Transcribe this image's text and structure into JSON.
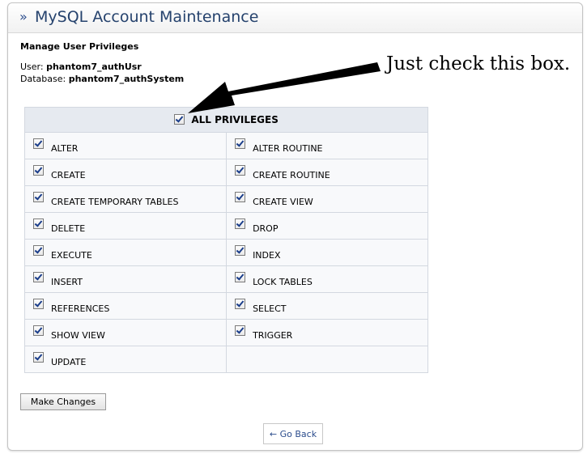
{
  "header": {
    "raquo": "»",
    "title": "MySQL Account Maintenance"
  },
  "section_title": "Manage User Privileges",
  "account": {
    "user_label": "User:",
    "user_value": "phantom7_authUsr",
    "database_label": "Database:",
    "database_value": "phantom7_authSystem"
  },
  "callout": "Just check this box.",
  "all_privileges": {
    "label": "ALL PRIVILEGES",
    "checked": true
  },
  "privileges": [
    {
      "label": "ALTER",
      "checked": true
    },
    {
      "label": "ALTER ROUTINE",
      "checked": true
    },
    {
      "label": "CREATE",
      "checked": true
    },
    {
      "label": "CREATE ROUTINE",
      "checked": true
    },
    {
      "label": "CREATE TEMPORARY TABLES",
      "checked": true
    },
    {
      "label": "CREATE VIEW",
      "checked": true
    },
    {
      "label": "DELETE",
      "checked": true
    },
    {
      "label": "DROP",
      "checked": true
    },
    {
      "label": "EXECUTE",
      "checked": true
    },
    {
      "label": "INDEX",
      "checked": true
    },
    {
      "label": "INSERT",
      "checked": true
    },
    {
      "label": "LOCK TABLES",
      "checked": true
    },
    {
      "label": "REFERENCES",
      "checked": true
    },
    {
      "label": "SELECT",
      "checked": true
    },
    {
      "label": "SHOW VIEW",
      "checked": true
    },
    {
      "label": "TRIGGER",
      "checked": true
    },
    {
      "label": "UPDATE",
      "checked": true
    }
  ],
  "buttons": {
    "make_changes": "Make Changes",
    "go_back": "← Go Back"
  }
}
